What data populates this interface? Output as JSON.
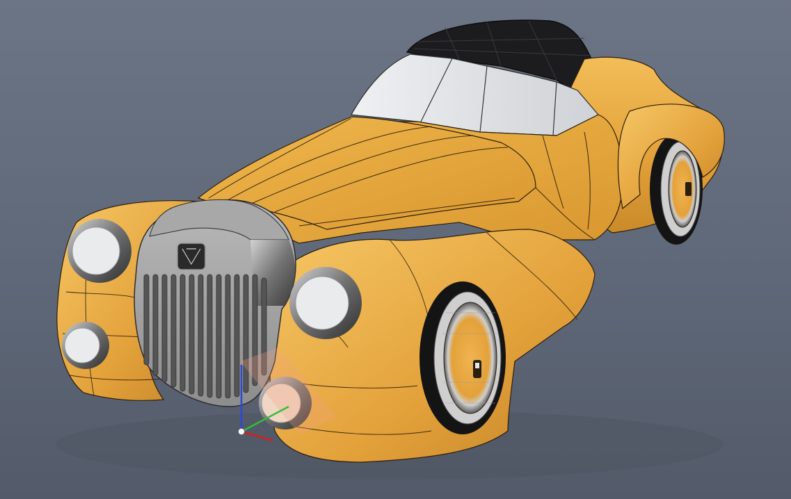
{
  "viewport": {
    "background_top": "#6c7585",
    "background_bottom": "#535b6a"
  },
  "model": {
    "body_color": "#e6a63c",
    "top_color": "#1c1c1e",
    "glass_color": "#e4e6e8",
    "chrome_color": "#8a8a8a",
    "lamp_lens_color": "#e9ebed",
    "edge_line_color": "#2a1e10"
  },
  "triad": {
    "x_axis_color": "#d81e1e",
    "y_axis_color": "#2fbf3a",
    "z_axis_color": "#2b46d8",
    "origin_color": "#ffffff"
  }
}
